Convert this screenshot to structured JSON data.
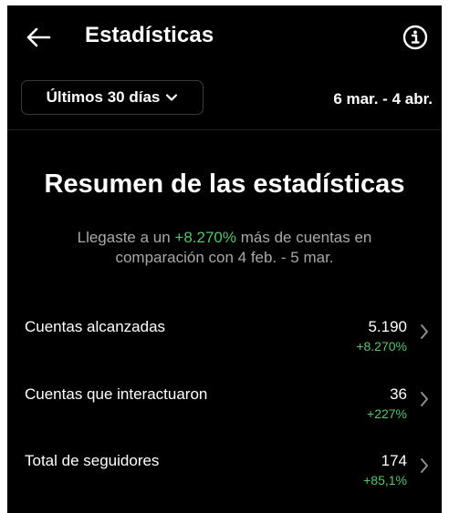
{
  "header": {
    "title": "Estadísticas",
    "back_icon": "arrow-left-icon",
    "info_icon": "info-icon"
  },
  "filter": {
    "range_label": "Últimos 30 días",
    "date_range": "6 mar. - 4 abr."
  },
  "summary": {
    "title": "Resumen de las estadísticas",
    "desc_prefix": "Llegaste a un ",
    "desc_highlight": "+8.270%",
    "desc_suffix": " más de cuentas en comparación con 4 feb. - 5 mar."
  },
  "metrics": [
    {
      "label": "Cuentas alcanzadas",
      "value": "5.190",
      "change": "+8.270%"
    },
    {
      "label": "Cuentas que interactuaron",
      "value": "36",
      "change": "+227%"
    },
    {
      "label": "Total de seguidores",
      "value": "174",
      "change": "+85,1%"
    }
  ],
  "colors": {
    "background": "#000000",
    "text": "#ffffff",
    "muted": "#a8a8a8",
    "positive": "#58c36d",
    "border": "#3a3a3a"
  }
}
